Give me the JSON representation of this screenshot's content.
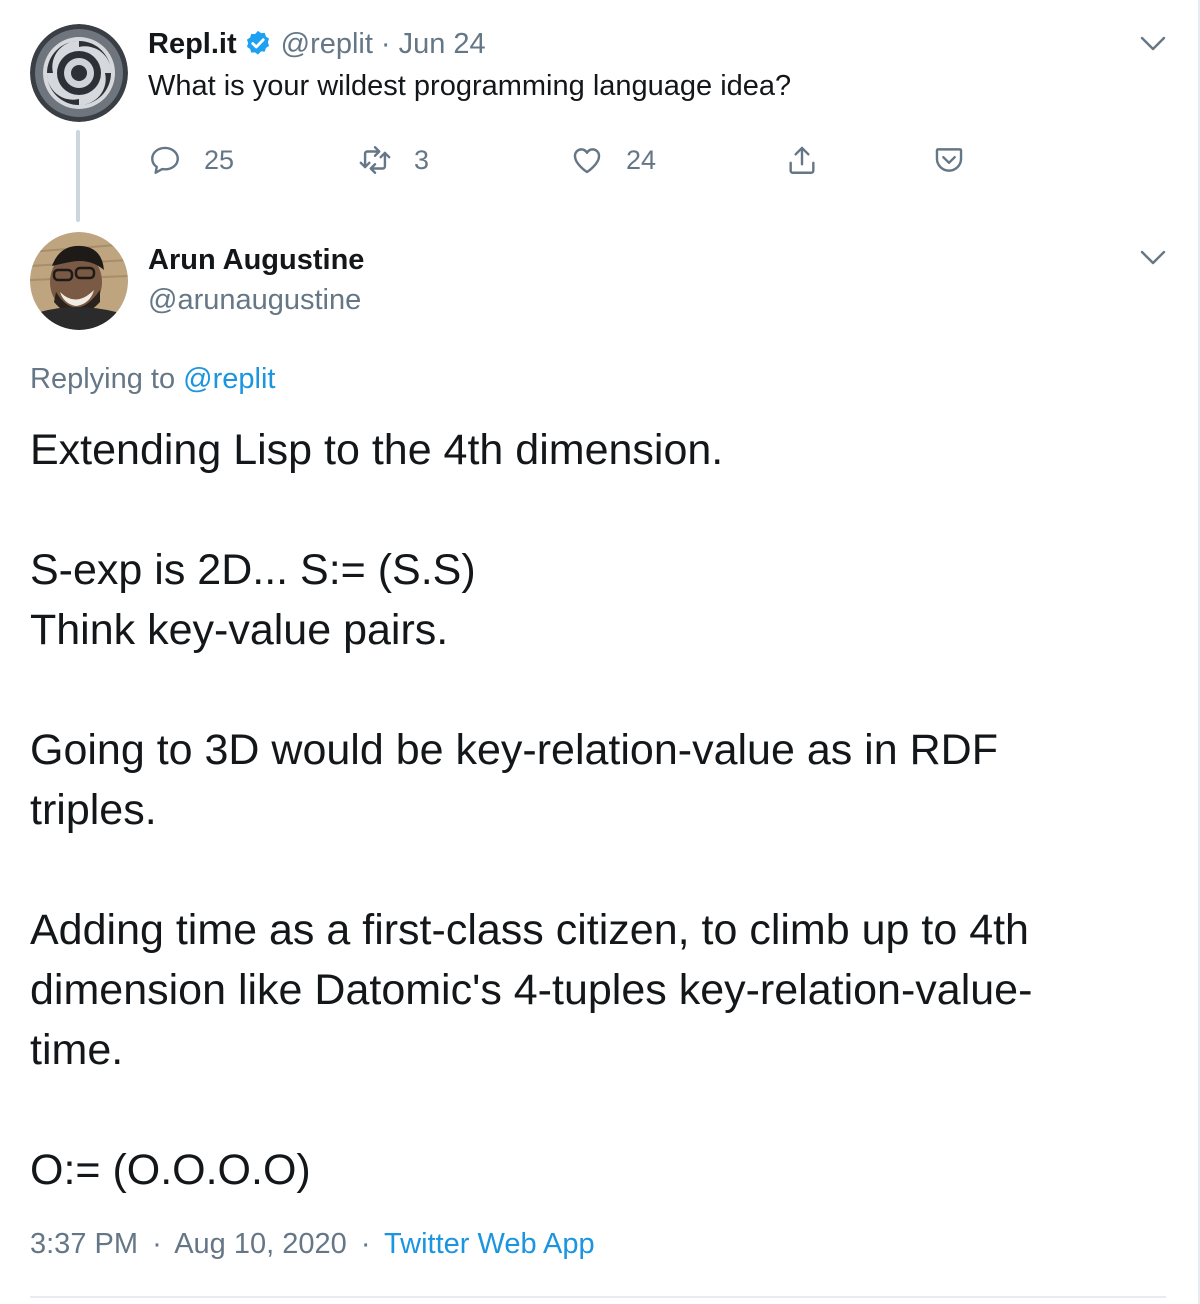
{
  "parent_tweet": {
    "display_name": "Repl.it",
    "handle": "@replit",
    "date": "Jun 24",
    "separator": "·",
    "text": "What is your wildest programming language idea?",
    "actions": {
      "reply_count": "25",
      "retweet_count": "3",
      "like_count": "24"
    },
    "icons": [
      "replit-logo-avatar",
      "verified-badge-icon",
      "chevron-down-icon",
      "reply-icon",
      "retweet-icon",
      "like-icon",
      "share-icon",
      "pocket-icon"
    ]
  },
  "reply_tweet": {
    "display_name": "Arun Augustine",
    "handle": "@arunaugustine",
    "replying_prefix": "Replying to",
    "replying_to": "@replit",
    "paragraphs": [
      [
        "Extending Lisp to the 4th dimension."
      ],
      [
        "S-exp is 2D... S:= (S.S)",
        "Think key-value pairs."
      ],
      [
        "Going to 3D would be key-relation-value as in RDF triples."
      ],
      [
        "Adding time as a first-class citizen, to climb up to 4th dimension like Datomic's 4-tuples key-relation-value-time."
      ],
      [
        "O:= (O.O.O.O)"
      ]
    ],
    "time": "3:37 PM",
    "separator": "·",
    "date": "Aug 10, 2020",
    "source": "Twitter Web App"
  },
  "colors": {
    "text": "#14171a",
    "muted": "#657786",
    "link": "#1b95e0",
    "verified": "#1da1f2",
    "divider": "#e6ecf0"
  }
}
